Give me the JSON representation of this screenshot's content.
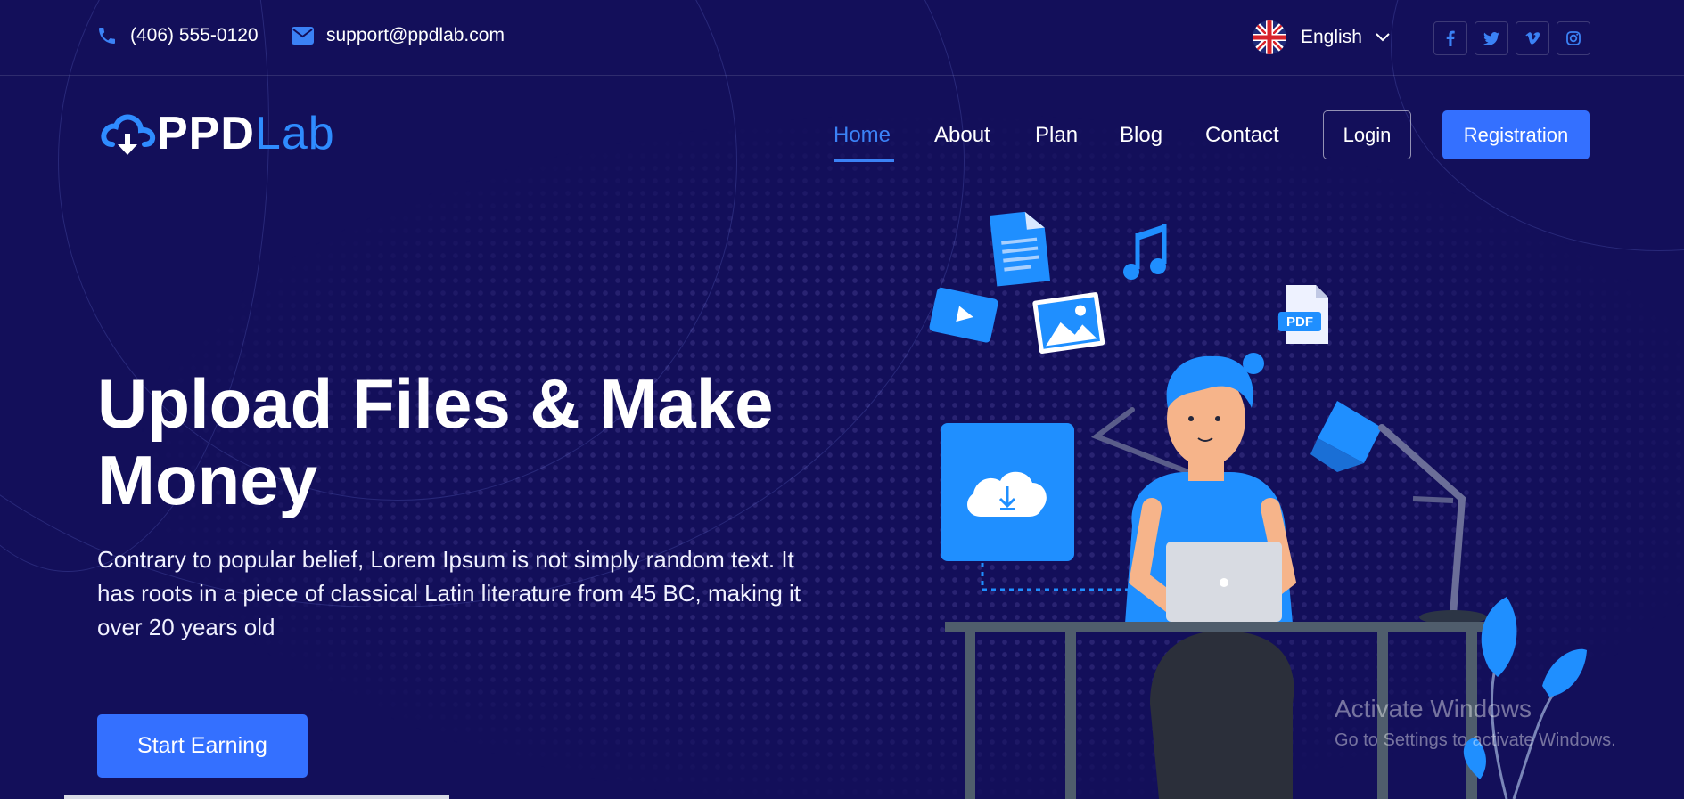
{
  "topbar": {
    "phone": "(406) 555-0120",
    "email": "support@ppdlab.com",
    "language": "English",
    "social": [
      {
        "icon": "facebook-icon",
        "glyph": "f"
      },
      {
        "icon": "twitter-icon",
        "glyph": "t"
      },
      {
        "icon": "vimeo-icon",
        "glyph": "v"
      },
      {
        "icon": "instagram-icon",
        "glyph": "ig"
      }
    ]
  },
  "logo": {
    "part1": "PPD",
    "part2": "Lab"
  },
  "nav": {
    "items": [
      {
        "label": "Home",
        "active": true
      },
      {
        "label": "About"
      },
      {
        "label": "Plan"
      },
      {
        "label": "Blog"
      },
      {
        "label": "Contact"
      }
    ],
    "login": "Login",
    "registration": "Registration"
  },
  "hero": {
    "title": "Upload Files & Make Money",
    "text": "Contrary to popular belief, Lorem Ipsum is not simply random text. It has roots in a piece of classical Latin literature from 45 BC, making it over 20 years old",
    "cta": "Start Earning"
  },
  "illustration": {
    "pdf_label": "PDF"
  },
  "watermark": {
    "title": "Activate Windows",
    "subtitle": "Go to Settings to activate Windows."
  },
  "colors": {
    "background": "#130f5a",
    "accent": "#3470ff",
    "icon_blue": "#1f8fff"
  }
}
